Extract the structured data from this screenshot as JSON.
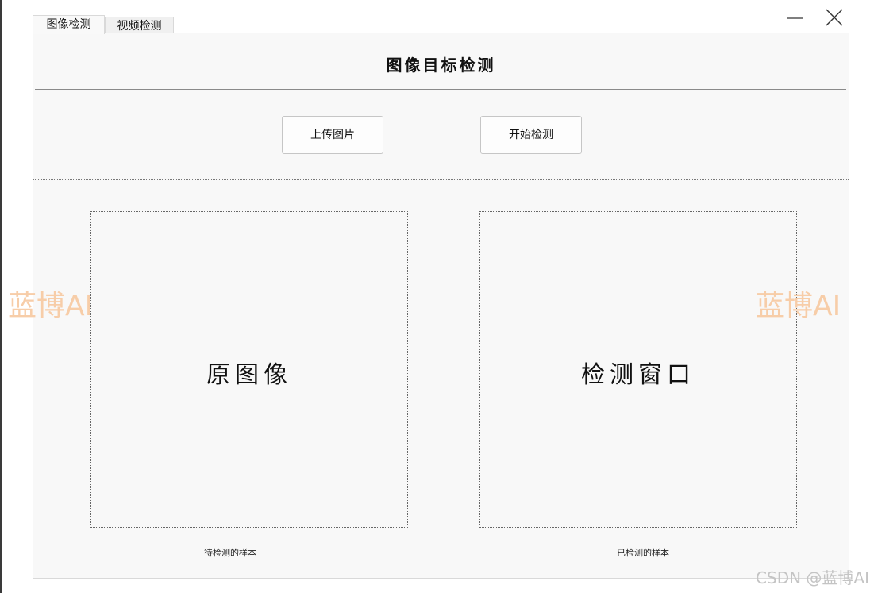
{
  "window": {
    "minimize_icon": "minimize-icon",
    "close_icon": "close-icon"
  },
  "tabs": [
    {
      "label": "图像检测",
      "active": true
    },
    {
      "label": "视频检测",
      "active": false
    }
  ],
  "main": {
    "title": "图像目标检测",
    "buttons": {
      "upload_label": "上传图片",
      "detect_label": "开始检测"
    },
    "original_panel": {
      "label": "原图像",
      "caption": "待检测的样本"
    },
    "result_panel": {
      "label": "检测窗口",
      "caption": "已检测的样本"
    }
  },
  "watermarks": {
    "left": "蓝博AI",
    "right": "蓝博AI",
    "footer": "CSDN @蓝博AI"
  },
  "colors": {
    "panel_background": "#f8f8f8",
    "watermark": "#f7cda8",
    "footer_watermark": "#c4c4c4"
  }
}
